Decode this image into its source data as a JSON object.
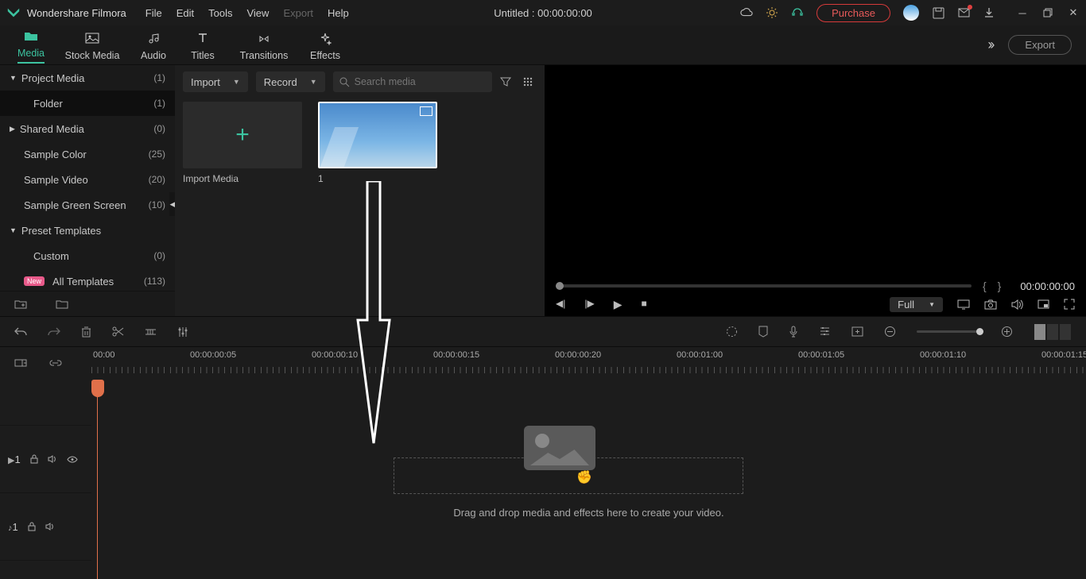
{
  "app": {
    "name": "Wondershare Filmora",
    "title": "Untitled : 00:00:00:00"
  },
  "menu": {
    "file": "File",
    "edit": "Edit",
    "tools": "Tools",
    "view": "View",
    "export": "Export",
    "help": "Help"
  },
  "titlebar": {
    "purchase": "Purchase"
  },
  "tabs": {
    "media": "Media",
    "stock": "Stock Media",
    "audio": "Audio",
    "titles": "Titles",
    "transitions": "Transitions",
    "effects": "Effects",
    "export": "Export"
  },
  "sidebar": {
    "items": [
      {
        "label": "Project Media",
        "count": "(1)"
      },
      {
        "label": "Folder",
        "count": "(1)"
      },
      {
        "label": "Shared Media",
        "count": "(0)"
      },
      {
        "label": "Sample Color",
        "count": "(25)"
      },
      {
        "label": "Sample Video",
        "count": "(20)"
      },
      {
        "label": "Sample Green Screen",
        "count": "(10)"
      },
      {
        "label": "Preset Templates",
        "count": ""
      },
      {
        "label": "Custom",
        "count": "(0)"
      },
      {
        "label": "All Templates",
        "count": "(113)"
      }
    ],
    "new": "New"
  },
  "mediabar": {
    "import": "Import",
    "record": "Record",
    "search_ph": "Search media"
  },
  "thumbs": {
    "import": "Import Media",
    "clip1": "1"
  },
  "preview": {
    "time": "00:00:00:00",
    "quality": "Full"
  },
  "timeline": {
    "stamps": [
      "00:00",
      "00:00:00:05",
      "00:00:00:10",
      "00:00:00:15",
      "00:00:00:20",
      "00:00:01:00",
      "00:00:01:05",
      "00:00:01:10",
      "00:00:01:15"
    ],
    "drop": "Drag and drop media and effects here to create your video.",
    "vtrack": "1",
    "atrack": "1"
  }
}
